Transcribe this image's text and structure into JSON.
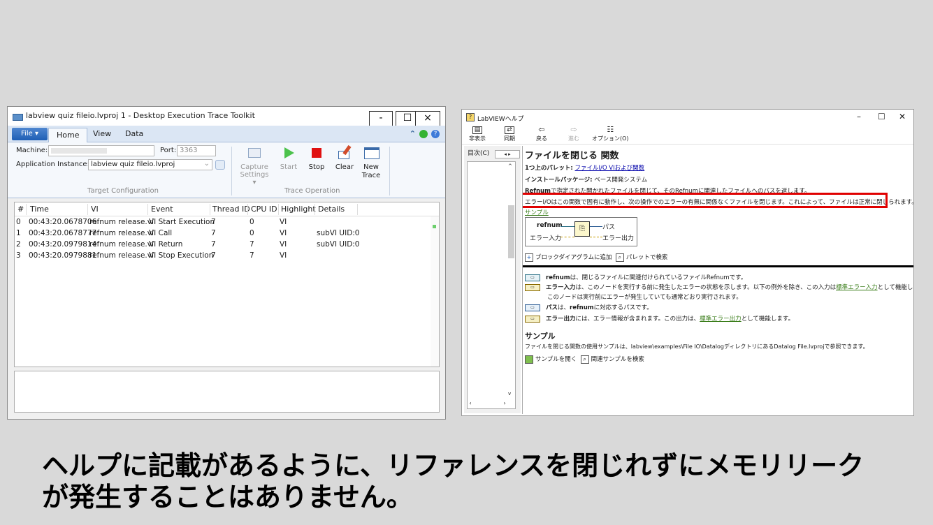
{
  "trace_window": {
    "title": "labview quiz fileio.lvproj 1 - Desktop Execution Trace Toolkit",
    "window_buttons": {
      "minimize": "-",
      "maximize": "☐",
      "close": "×"
    },
    "file_tab": "File ▾",
    "tabs": [
      "Home",
      "View",
      "Data"
    ],
    "machine_label": "Machine:",
    "machine_value": "",
    "port_label": "Port:",
    "port_value": "3363",
    "app_instance_label": "Application Instance:",
    "app_instance_value": "labview quiz fileio.lvproj",
    "group1_label": "Target Configuration",
    "group2_label": "Trace Operation",
    "buttons": {
      "capture_settings": "Capture Settings ▾",
      "start": "Start",
      "stop": "Stop",
      "clear": "Clear",
      "new_trace": "New Trace"
    },
    "columns": [
      "#",
      "Time",
      "VI",
      "Event",
      "Thread ID",
      "CPU ID",
      "Highlight",
      "Details"
    ],
    "rows": [
      [
        "0",
        "00:43:20.0678706",
        "refnum release.vi",
        "VI Start Execution",
        "7",
        "0",
        "VI",
        ""
      ],
      [
        "1",
        "00:43:20.0678777",
        "refnum release.vi",
        "VI Call",
        "7",
        "0",
        "VI",
        "subVI UID:0"
      ],
      [
        "2",
        "00:43:20.0979814",
        "refnum release.vi",
        "VI Return",
        "7",
        "7",
        "VI",
        "subVI UID:0"
      ],
      [
        "3",
        "00:43:20.0979881",
        "refnum release.vi",
        "VI Stop Execution",
        "7",
        "7",
        "VI",
        ""
      ]
    ]
  },
  "help_window": {
    "title": "LabVIEWヘルプ",
    "window_buttons": {
      "minimize": "–",
      "maximize": "☐",
      "close": "✕"
    },
    "toolbar": {
      "hide": "非表示",
      "sync": "同期",
      "back": "戻る",
      "forward": "進む",
      "options": "オプション(O)"
    },
    "nav_tab": "目次(C)",
    "page_title": "ファイルを閉じる 関数",
    "palette_label": "1つ上のパレット:",
    "palette_link": "ファイルI/O VIおよび関数",
    "package_label": "インストールパッケージ:",
    "package_value": "ベース開発システム",
    "desc1_bold": "Refnum",
    "desc1": "で指定された開かれたファイルを閉じて、そのRefnumに関連したファイルへのパスを返します。",
    "desc2": "エラーI/Oはこの関数で固有に動作し、次の操作でのエラーの有無に関係なくファイルを閉じます。これによって、ファイルは正常に閉じられます。",
    "sample_link": "サンプル",
    "node": {
      "refnum": "refnum",
      "error_in": "エラー入力",
      "path": "パス",
      "error_out": "エラー出力"
    },
    "add_to_bd": "ブロックダイアグラムに追加",
    "find_on_palette": "パレットで検索",
    "terminals": [
      {
        "tag": "refnum",
        "name": "refnum",
        "text": "は、閉じるファイルに関連付けられているファイルRefnumです。",
        "link": "",
        "suffix": ""
      },
      {
        "tag": "err",
        "name": "エラー入力",
        "text": "は、このノードを実行する前に発生したエラーの状態を示します。以下の例外を除き、この入力は",
        "link": "標準エラー入力",
        "suffix": "として機能します。"
      },
      {
        "tag": "path",
        "name": "パス",
        "text": "は、",
        "link": "",
        "suffix": "refnumに対応するパスです。"
      },
      {
        "tag": "err",
        "name": "エラー出力",
        "text": "には、エラー情報が含まれます。この出力は、",
        "link": "標準エラー出力",
        "suffix": "として機能します。"
      }
    ],
    "terminal2_note": "このノードは実行前にエラーが発生していても通常どおり実行されます。",
    "sample_heading": "サンプル",
    "sample_text": "ファイルを閉じる関数の使用サンプルは、labview\\examples\\File IO\\DatalogディレクトリにあるDatalog File.lvprojで参照できます。",
    "open_sample": "サンプルを開く",
    "find_sample": "関連サンプルを検索"
  },
  "caption": {
    "line1": "ヘルプに記載があるように、リファレンスを閉じれずにメモリリーク",
    "line2": "が発生することはありません。"
  }
}
